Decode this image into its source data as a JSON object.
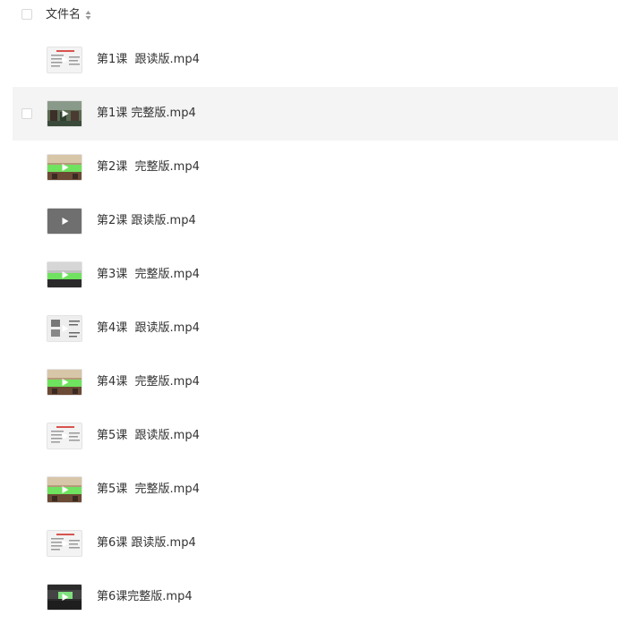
{
  "header": {
    "column_label": "文件名"
  },
  "files": [
    {
      "name": "第1课  跟读版.mp4",
      "thumb": "slide-red"
    },
    {
      "name": "第1课 完整版.mp4",
      "thumb": "classroom"
    },
    {
      "name": "第2课  完整版.mp4",
      "thumb": "classroom-green"
    },
    {
      "name": "第2课 跟读版.mp4",
      "thumb": "gray"
    },
    {
      "name": "第3课  完整版.mp4",
      "thumb": "classroom-green-dark"
    },
    {
      "name": "第4课  跟读版.mp4",
      "thumb": "slide-text"
    },
    {
      "name": "第4课  完整版.mp4",
      "thumb": "classroom-green"
    },
    {
      "name": "第5课  跟读版.mp4",
      "thumb": "slide-red"
    },
    {
      "name": "第5课  完整版.mp4",
      "thumb": "classroom-green"
    },
    {
      "name": "第6课 跟读版.mp4",
      "thumb": "slide-red"
    },
    {
      "name": "第6课完整版.mp4",
      "thumb": "classroom-dark"
    }
  ],
  "colors": {
    "hover_row": "#f4f4f4",
    "text": "#333333",
    "checkbox_border": "#d9d9d9"
  }
}
